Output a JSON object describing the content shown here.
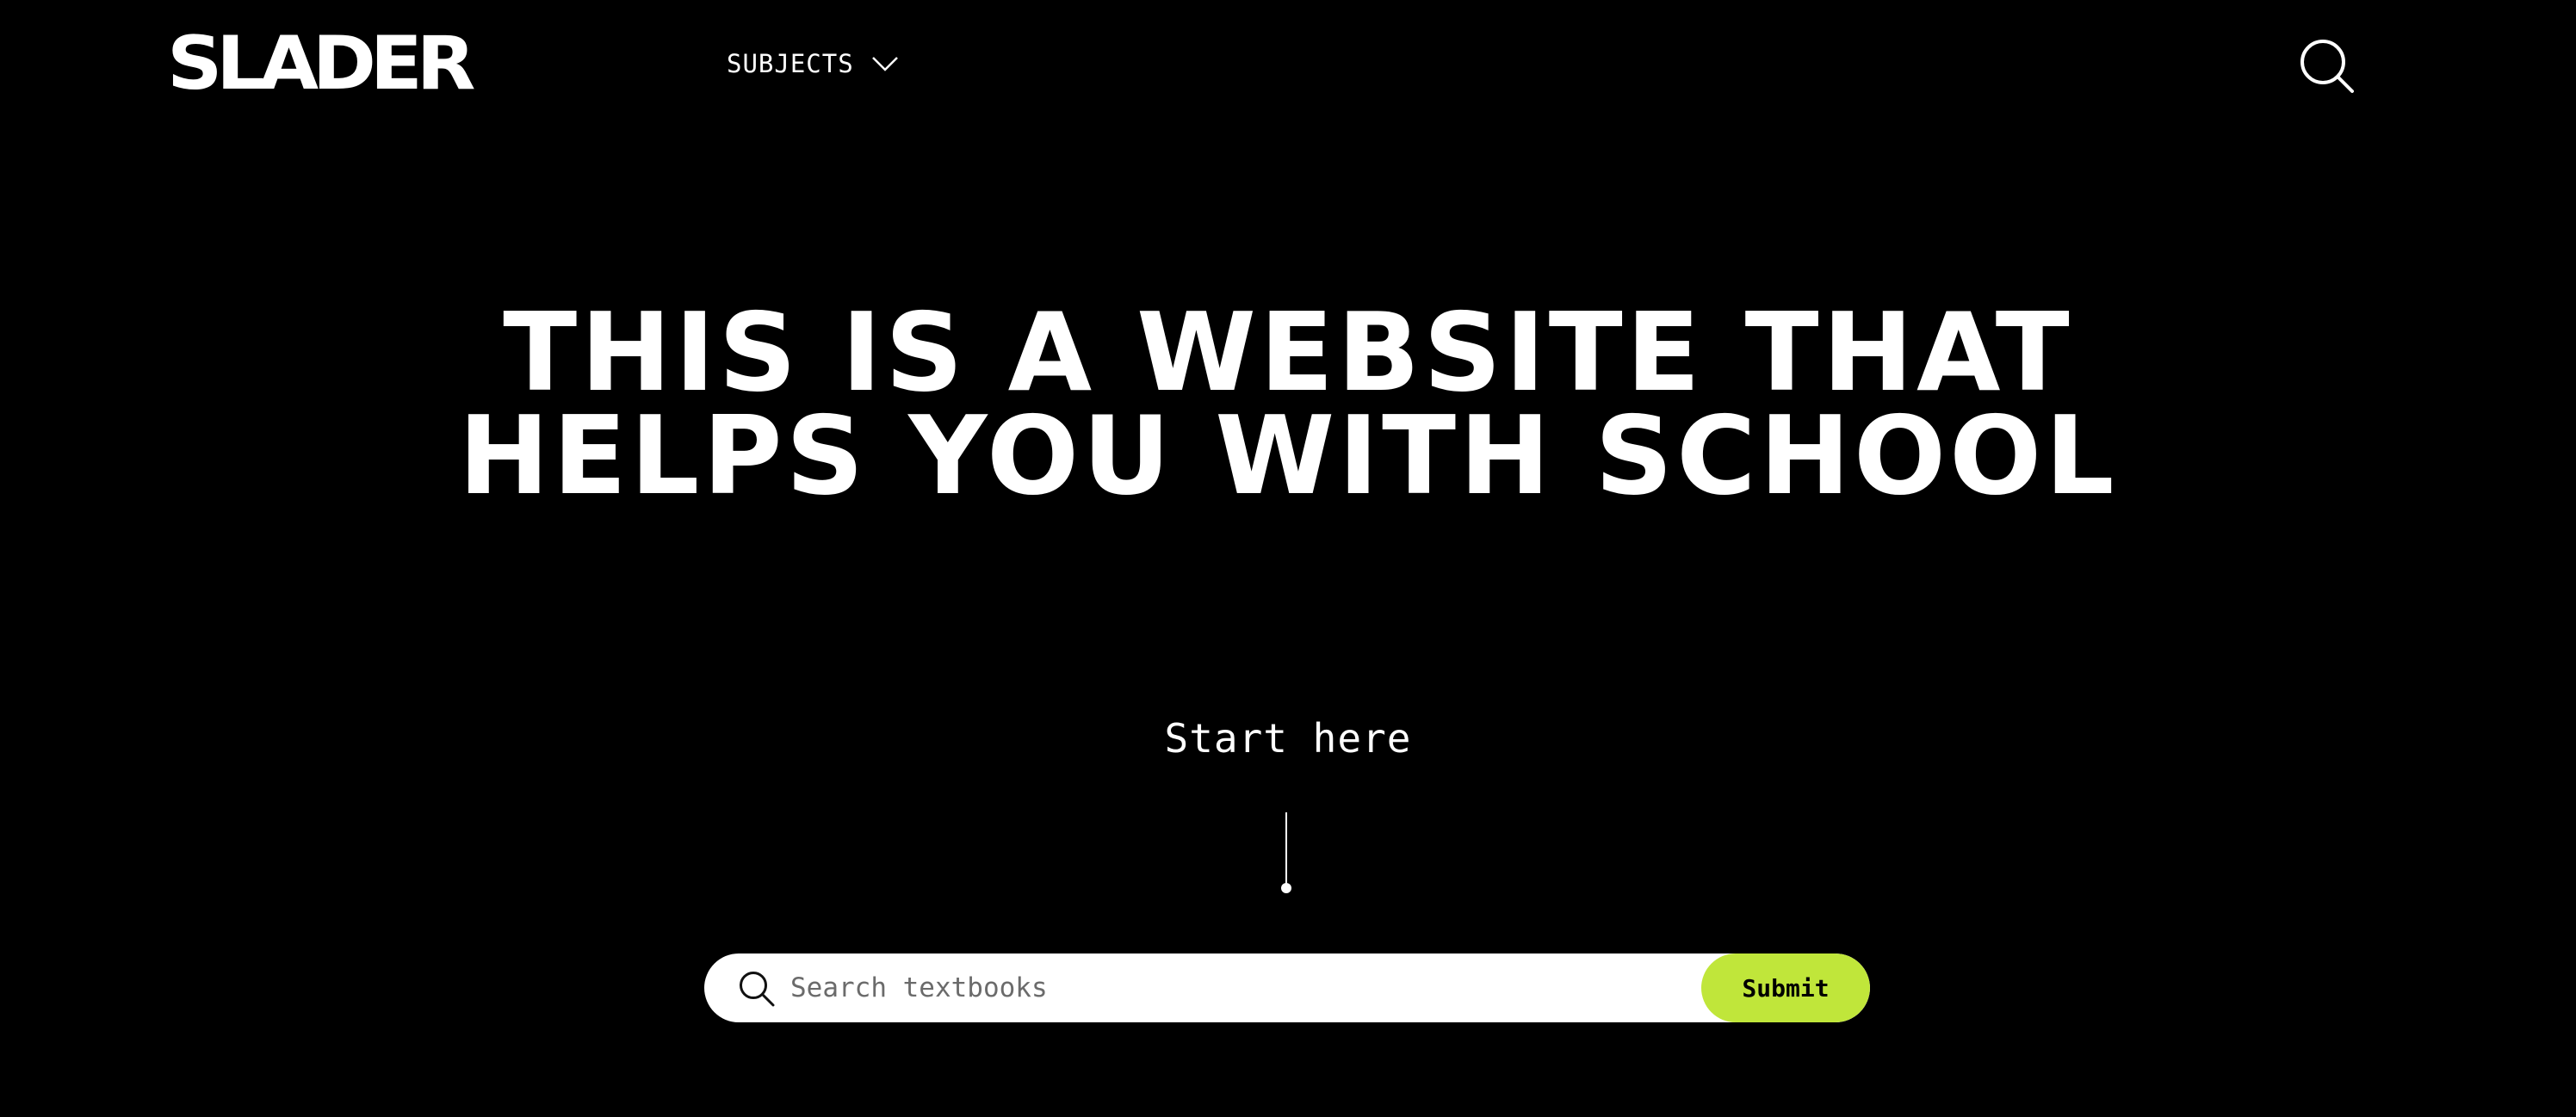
{
  "header": {
    "logo_text": "SLADER",
    "nav": {
      "subjects_label": "SUBJECTS",
      "subjects_icon": "chevron-down-icon"
    },
    "search_icon": "search-icon"
  },
  "hero": {
    "headline": "THIS IS A WEBSITE THAT HELPS YOU WITH SCHOOL",
    "cta_text": "Start here"
  },
  "search": {
    "icon": "search-icon",
    "placeholder": "Search textbooks",
    "value": "",
    "submit_label": "Submit"
  },
  "colors": {
    "background": "#000000",
    "foreground": "#ffffff",
    "accent": "#c0e63a"
  }
}
